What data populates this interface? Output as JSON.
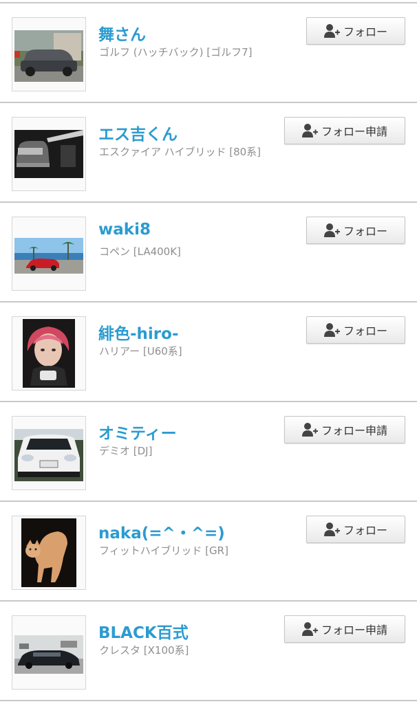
{
  "users": [
    {
      "name": "舞さん",
      "car": "ゴルフ (ハッチバック) [ゴルフ7]",
      "button": "フォロー",
      "thumb": "silver-hatchback-photo"
    },
    {
      "name": "エス吉くん",
      "car": "エスクァイア ハイブリッド [80系]",
      "button": "フォロー申請",
      "thumb": "black-and-white-van-photo"
    },
    {
      "name": "waki8",
      "car": "コペン [LA400K]",
      "button": "フォロー",
      "thumb": "red-convertible-seaside-photo"
    },
    {
      "name": "緋色-hiro-",
      "car": "ハリアー [U60系]",
      "button": "フォロー",
      "thumb": "person-portrait-photo"
    },
    {
      "name": "オミティー",
      "car": "デミオ [DJ]",
      "button": "フォロー申請",
      "thumb": "white-car-front-photo"
    },
    {
      "name": "naka(=^・^=)",
      "car": "フィットハイブリッド [GR]",
      "button": "フォロー",
      "thumb": "cat-photo"
    },
    {
      "name": "BLACK百式",
      "car": "クレスタ [X100系]",
      "button": "フォロー申請",
      "thumb": "black-sedan-photo"
    }
  ],
  "icons": {
    "follow": "add-user-icon"
  },
  "colors": {
    "name": "#2b9bd0",
    "subtext": "#8e8e8e",
    "divider": "#c8c8c8"
  }
}
